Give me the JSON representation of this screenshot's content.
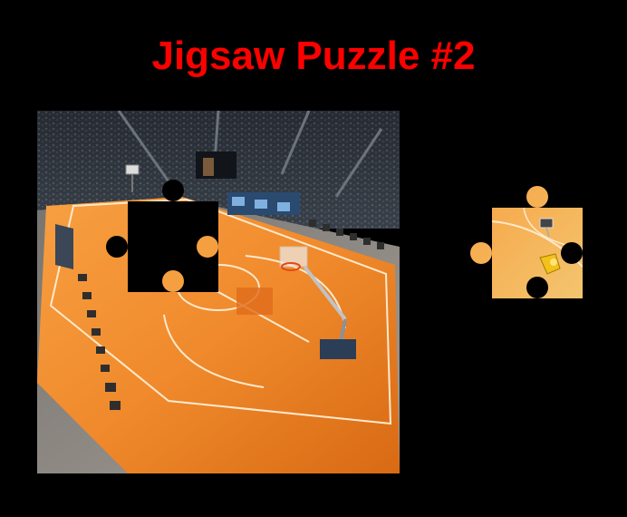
{
  "title": "Jigsaw Puzzle #2",
  "colors": {
    "background": "#000000",
    "title": "#ff0000",
    "court": "#f0892a",
    "court_light": "#ffb45c",
    "stands": "#2a2f36",
    "floor": "#8a8580"
  }
}
